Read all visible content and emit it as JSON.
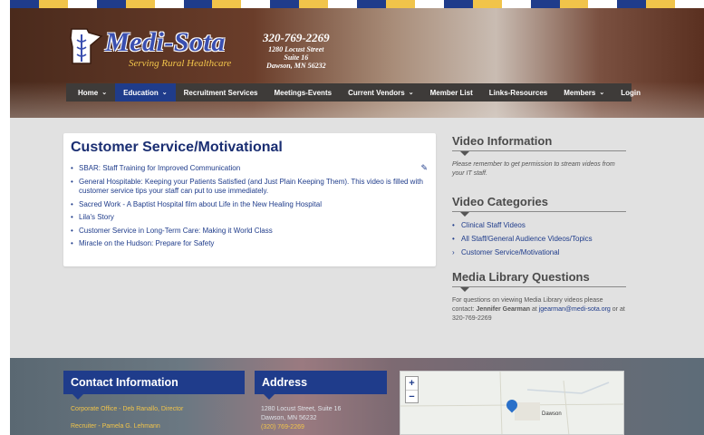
{
  "colors": {
    "accent": "#1f3c8b",
    "nav_bg": "#3e3b39",
    "gold": "#f1c44a"
  },
  "header": {
    "logo_title": "Medi-Sota",
    "logo_tagline": "Serving Rural Healthcare",
    "phone": "320-769-2269",
    "address_lines": [
      "1280 Locust Street",
      "Suite 16",
      "Dawson, MN 56232"
    ]
  },
  "nav": {
    "items": [
      {
        "label": "Home",
        "chevron": "⌄"
      },
      {
        "label": "Education",
        "chevron": "⌄"
      },
      {
        "label": "Recruitment Services",
        "chevron": ""
      },
      {
        "label": "Meetings-Events",
        "chevron": ""
      },
      {
        "label": "Current Vendors",
        "chevron": "⌄"
      },
      {
        "label": "Member List",
        "chevron": ""
      },
      {
        "label": "Links-Resources",
        "chevron": ""
      },
      {
        "label": "Members",
        "chevron": "⌄"
      },
      {
        "label": "Login",
        "chevron": ""
      }
    ]
  },
  "card": {
    "title": "Customer Service/Motivational",
    "edit_icon": "edit-icon",
    "items": [
      "SBAR: Staff Training for Improved Communication",
      "General Hospitable: Keeping your Patients Satisfied (and Just Plain Keeping Them). This video is filled with customer service tips your staff can put to use immediately.",
      "Sacred Work - A Baptist Hospital film about Life in the New Healing Hospital",
      "Lila's Story",
      "Customer Service in Long-Term Care: Making it World Class",
      "Miracle on the Hudson: Prepare for Safety"
    ]
  },
  "sidebar": {
    "video_info_title": "Video Information",
    "video_info_text": "Please remember to get permission to stream videos from your IT staff.",
    "categories_title": "Video Categories",
    "categories": [
      {
        "bullet": "•",
        "label": "Clinical Staff Videos"
      },
      {
        "bullet": "•",
        "label": "All Staff/General Audience Videos/Topics"
      },
      {
        "bullet": "›",
        "label": "Customer Service/Motivational"
      }
    ],
    "questions_title": "Media Library Questions",
    "questions_text_1": "For questions on viewing Media Library videos please contact: ",
    "questions_contact": "Jennifer Gearman",
    "questions_text_2": " at ",
    "questions_email": "jgearman@medi-sota.org",
    "questions_text_3": " or at 320-769-2269"
  },
  "footer": {
    "contact_title": "Contact Information",
    "contact_links": [
      "Corporate Office - Deb Ranallo, Director",
      "Recruiter - Pamela G. Lehmann"
    ],
    "address_title": "Address",
    "address_lines": [
      "1280 Locust Street, Suite 16",
      "Dawson, MN 56232"
    ],
    "address_phone": "(320) 769-2269",
    "map": {
      "zoom_in": "+",
      "zoom_out": "−",
      "place_label": "Dawson"
    }
  }
}
